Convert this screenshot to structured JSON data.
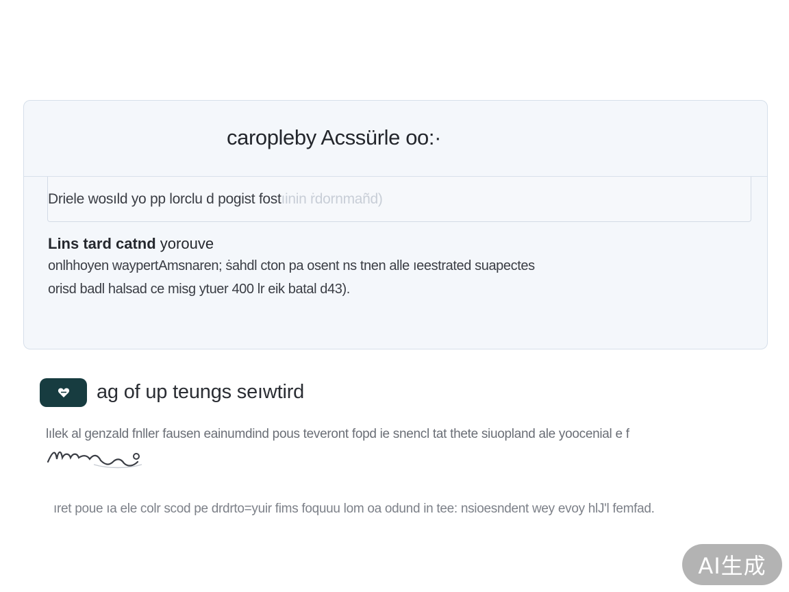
{
  "card": {
    "title": "caropleby Acssürle oo:·",
    "prompt": {
      "value": "Driele wosıld yo pp  lorclu d pogist fost",
      "placeholder": " ıinin ṙdornmañd)"
    },
    "heading_bold": "Lins tard catnd",
    "heading_rest": " yorouve",
    "lines": [
      "onlhhoyen waypertAmsnaren; ṡahdl cton pa osent ns tnen alle ıeestrated suapectes",
      "orisd badl halsad ce misg ytuer  400  lr eik batal d43)."
    ]
  },
  "section": {
    "icon": "heart-icon",
    "title": "ag of up teungs seıwtird",
    "paragraph": "lılek al genzald fnller fausen eainumdind pous teveront fopd ie snencl tat thete siuopland ale yoocenial  e f"
  },
  "footer": {
    "text": "ıret poue ıa ele colr scod pe drdrto=yuir fims foquuu lom oa odund in tee: nsioesndent wey evoy hlJ'l femfad."
  },
  "badge": {
    "label": "AI生成"
  },
  "colors": {
    "card_bg": "#f4f7fb",
    "card_border": "#d6dfea",
    "icon_button": "#173c40",
    "badge_bg": "#969696"
  }
}
